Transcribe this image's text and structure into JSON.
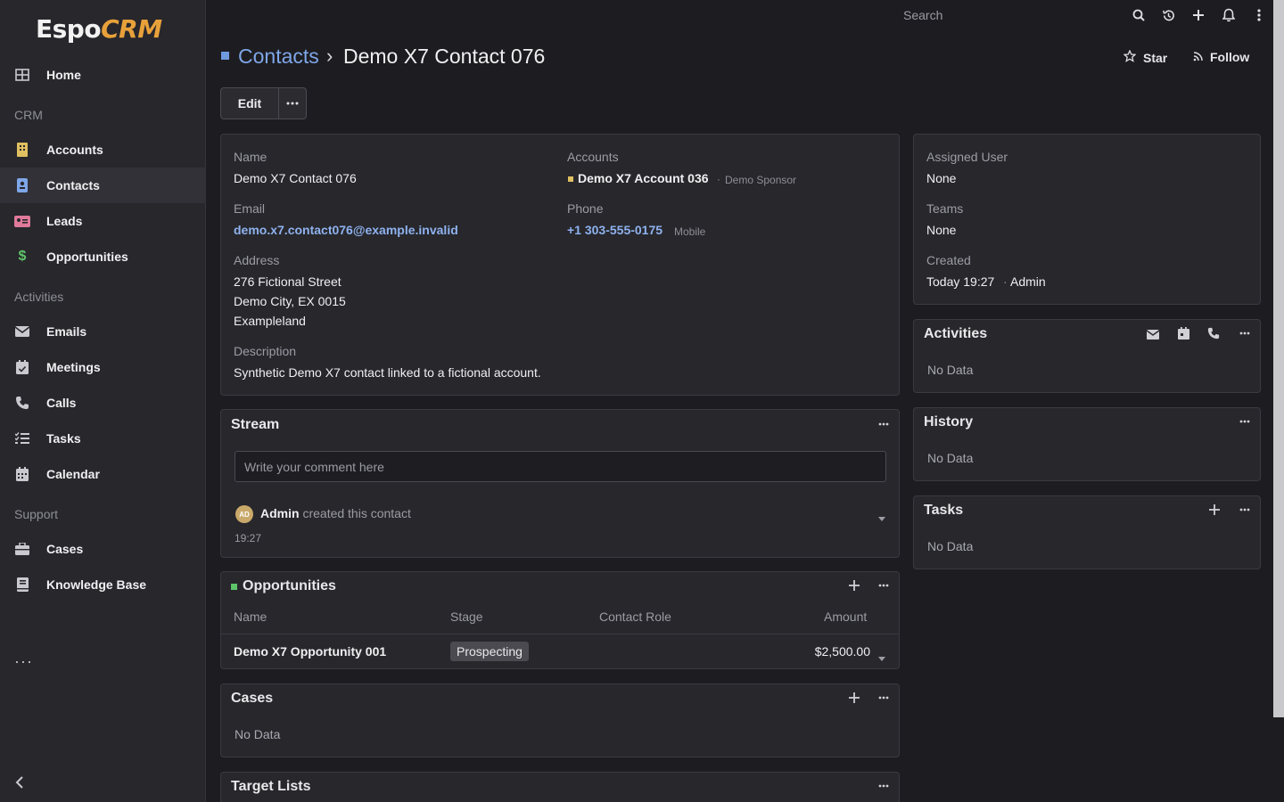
{
  "app": {
    "logo_main": "Espo",
    "logo_accent": "CRM"
  },
  "sidebar": {
    "items": [
      {
        "label": "Home",
        "icon": "home-icon"
      },
      {
        "label": "Accounts",
        "icon": "accounts-icon",
        "color": "#e0c060"
      },
      {
        "label": "Contacts",
        "icon": "contacts-icon",
        "color": "#7fa6e8"
      },
      {
        "label": "Leads",
        "icon": "leads-icon",
        "color": "#e07a9a"
      },
      {
        "label": "Opportunities",
        "icon": "dollar-icon",
        "color": "#5ec46a"
      },
      {
        "label": "Emails",
        "icon": "envelope-icon"
      },
      {
        "label": "Meetings",
        "icon": "calendar-check-icon"
      },
      {
        "label": "Calls",
        "icon": "phone-icon"
      },
      {
        "label": "Tasks",
        "icon": "tasks-icon"
      },
      {
        "label": "Calendar",
        "icon": "calendar-icon"
      },
      {
        "label": "Cases",
        "icon": "briefcase-icon"
      },
      {
        "label": "Knowledge Base",
        "icon": "book-icon"
      }
    ],
    "groups": [
      "CRM",
      "Activities",
      "Support"
    ],
    "more": "···"
  },
  "topbar": {
    "search_placeholder": "Search"
  },
  "header": {
    "breadcrumb_parent": "Contacts",
    "breadcrumb_sep": "›",
    "title": "Demo X7 Contact 076",
    "star_label": "Star",
    "follow_label": "Follow",
    "edit_label": "Edit"
  },
  "details": {
    "name_label": "Name",
    "name_value": "Demo X7 Contact 076",
    "accounts_label": "Accounts",
    "account_value": "Demo X7 Account 036",
    "account_role": "Demo Sponsor",
    "email_label": "Email",
    "email_value": "demo.x7.contact076@example.invalid",
    "phone_label": "Phone",
    "phone_value": "+1 303-555-0175",
    "phone_type": "Mobile",
    "address_label": "Address",
    "address_line1": "276 Fictional Street",
    "address_line2": "Demo City, EX 0015",
    "address_line3": "Exampleland",
    "description_label": "Description",
    "description_value": "Synthetic Demo X7 contact linked to a fictional account."
  },
  "side_details": {
    "assigned_label": "Assigned User",
    "assigned_value": "None",
    "teams_label": "Teams",
    "teams_value": "None",
    "created_label": "Created",
    "created_value": "Today 19:27",
    "created_by": "Admin"
  },
  "stream": {
    "title": "Stream",
    "comment_placeholder": "Write your comment here",
    "avatar": "AD",
    "user": "Admin",
    "action": "created this contact",
    "time": "19:27"
  },
  "opportunities": {
    "title": "Opportunities",
    "columns": [
      "Name",
      "Stage",
      "Contact Role",
      "Amount"
    ],
    "rows": [
      {
        "name": "Demo X7 Opportunity 001",
        "stage": "Prospecting",
        "role": "",
        "amount": "$2,500.00"
      }
    ]
  },
  "cases": {
    "title": "Cases",
    "nodata": "No Data"
  },
  "target_lists": {
    "title": "Target Lists"
  },
  "activities": {
    "title": "Activities",
    "nodata": "No Data"
  },
  "history": {
    "title": "History",
    "nodata": "No Data"
  },
  "tasks": {
    "title": "Tasks",
    "nodata": "No Data"
  }
}
